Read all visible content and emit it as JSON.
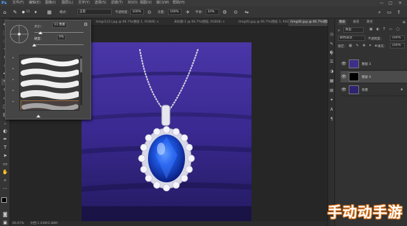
{
  "menubar": {
    "items": [
      "文件(F)",
      "编辑(E)",
      "图像(I)",
      "图层(L)",
      "文字(Y)",
      "选择(S)",
      "滤镜(T)",
      "3D(D)",
      "视图(V)",
      "窗口(W)",
      "帮助(H)"
    ],
    "window_controls": [
      "—",
      "□",
      "✕"
    ]
  },
  "options": {
    "brush_size": "11",
    "mode_label": "模式：",
    "mode_value": "正常",
    "opacity_label": "不透明度：",
    "opacity_value": "100%",
    "flow_label": "流量：",
    "flow_value": "100%",
    "smoothing_label": "平滑：",
    "smoothing_value": "10%"
  },
  "tabs": [
    {
      "label": "timg(1)(1).jpg @ 66.7%(图层 1, RGB/8) ×",
      "active": false
    },
    {
      "label": "未标题-1 @ 66.7%(图层, RGB/8) ×",
      "active": false
    },
    {
      "label": "timg(6).jpg @ 66.7%(图层 3, RGB/8) ×",
      "active": false
    },
    {
      "label": "timg(8).jpg @ 66.7%(图层 4, RGB/8) ×",
      "active": true
    }
  ],
  "brush_panel": {
    "size_label": "大小：",
    "size_value": "11 像素",
    "hardness_label": "硬度：",
    "hardness_value": "0%",
    "gear": "⚙",
    "size_fraction": 0.12,
    "hardness_fraction": 0.0,
    "brushes": [
      "",
      "",
      "",
      "",
      ""
    ],
    "selected_index": 4
  },
  "right_panel": {
    "tabs": [
      "图层",
      "通道",
      "路径"
    ],
    "kind_label": "类型",
    "blend_mode": "颜色减淡",
    "opacity_label": "不透明度：",
    "opacity_value": "100%",
    "lock_label": "锁定：",
    "fill_label": "填充：",
    "fill_value": "100%",
    "layers": [
      {
        "name": "图层 3",
        "thumb": "#3c2f8a",
        "selected": false
      },
      {
        "name": "图层 4",
        "thumb": "#000000",
        "selected": true
      },
      {
        "name": "背景",
        "thumb": "#2e2470",
        "selected": false,
        "locked": true
      }
    ]
  },
  "status": {
    "zoom": "66.67%",
    "doc_info": "文档:1.03M/2.88M"
  },
  "watermark": "手动动手游",
  "colors": {
    "accent": "#d46a1a",
    "fabric": "#3f2d93",
    "sapphire": "#1d4fd8"
  }
}
